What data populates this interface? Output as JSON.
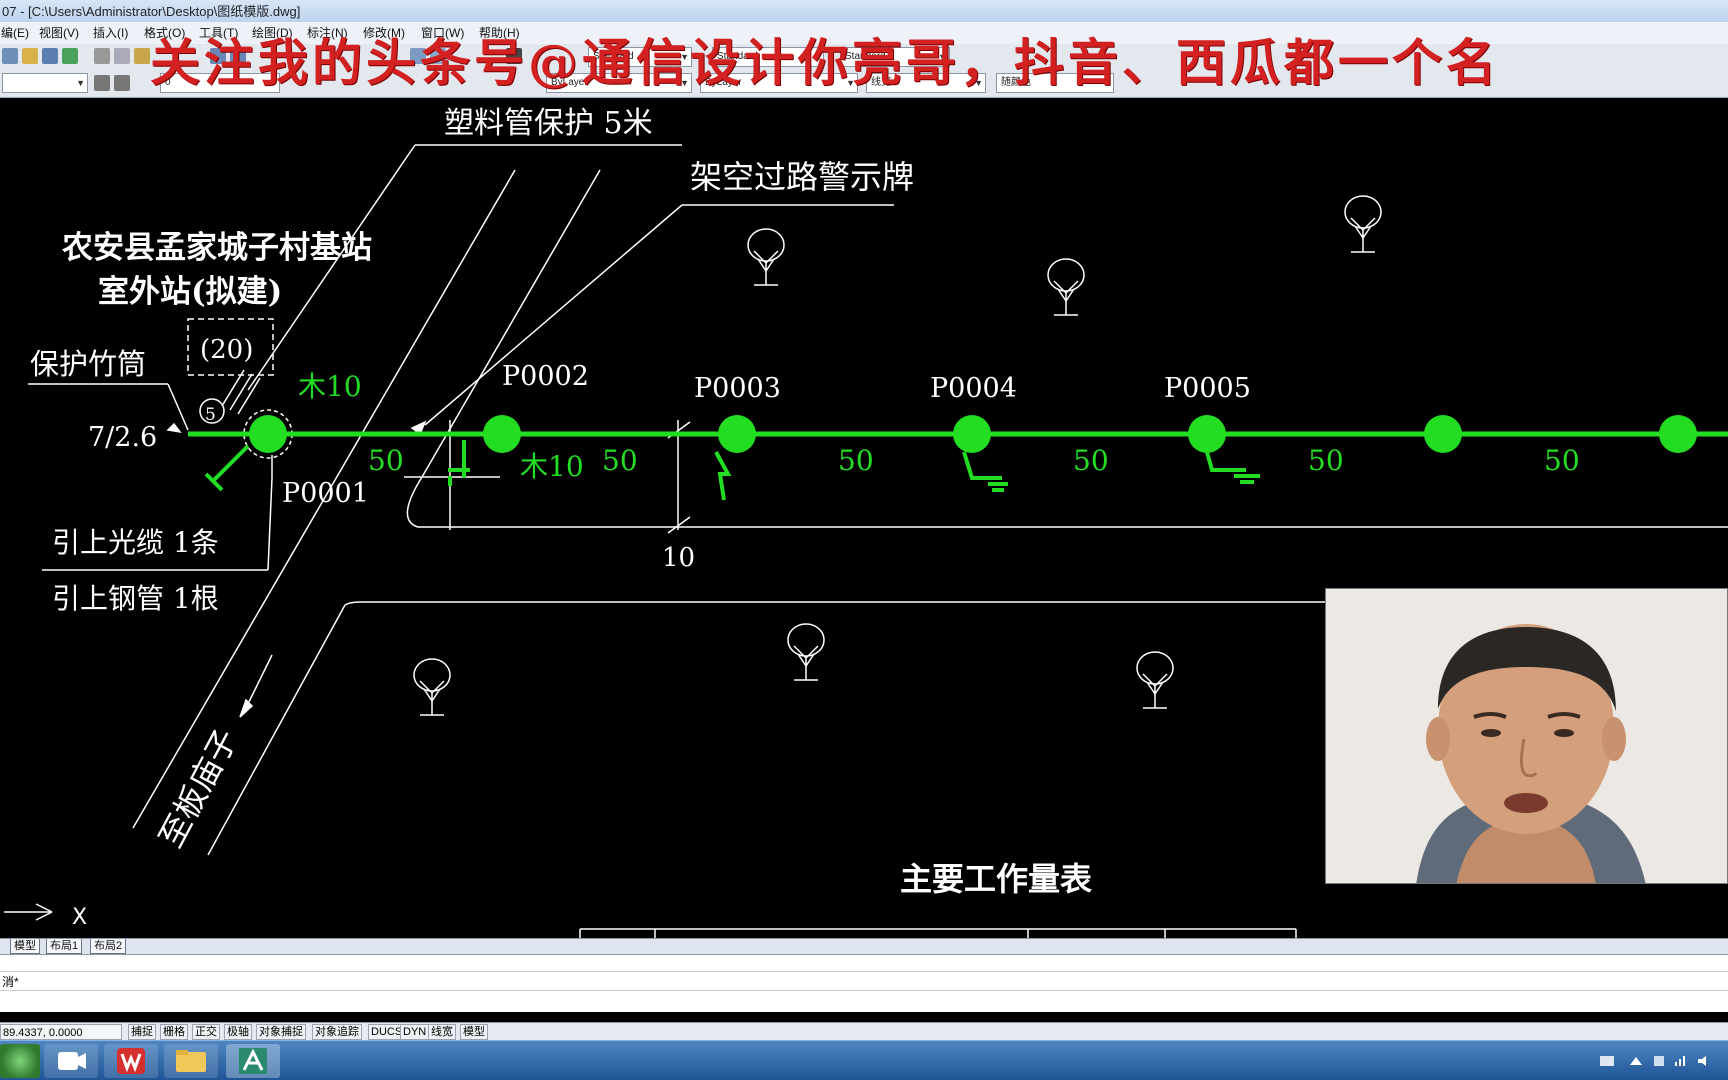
{
  "window": {
    "title": "07 - [C:\\Users\\Administrator\\Desktop\\图纸模版.dwg]"
  },
  "menu": {
    "items": [
      "编(E)",
      "视图(V)",
      "插入(I)",
      "格式(O)",
      "工具(T)",
      "绘图(D)",
      "标注(N)",
      "修改(M)",
      "窗口(W)",
      "帮助(H)"
    ]
  },
  "toolbar": {
    "text_style": "Standard",
    "dim_style": "Standard",
    "table_style": "Standard",
    "layer": "0",
    "color": "ByLayer",
    "linetype": "ByLayer",
    "lineweight": "线宽",
    "plotstyle": "随颜色"
  },
  "banner": {
    "text": "关注我的头条号@通信设计你亮哥，抖音、西瓜都一个名"
  },
  "drawing": {
    "colors": {
      "line_green": "#22dd22",
      "text_white": "#ffffff",
      "background": "#000000"
    },
    "labels": {
      "plastic_pipe": "塑料管保护 5米",
      "sign": "架空过路警示牌",
      "station_line1": "农安县孟家城子村基站",
      "station_line2": "室外站(拟建)",
      "bamboo": "保护竹筒",
      "paren20": "(20)",
      "circled5": "5",
      "cable_spec": "7/2.6",
      "cable_up": "引上光缆 1条",
      "steel_up": "引上钢管 1根",
      "road": "至板庙子",
      "span10": "10",
      "table_title": "主要工作量表",
      "wood1": "木10",
      "wood2": "木10",
      "axis_x": "X"
    },
    "poles": [
      "P0001",
      "P0002",
      "P0003",
      "P0004",
      "P0005"
    ],
    "spans": [
      "50",
      "50",
      "50",
      "50",
      "50",
      "50"
    ]
  },
  "layout_tabs": [
    "模型",
    "布局1",
    "布局2"
  ],
  "command": {
    "text": "消*"
  },
  "status": {
    "coords": "89.4337, 0.0000",
    "toggles": [
      "捕捉",
      "栅格",
      "正交",
      "极轴",
      "对象捕捉",
      "对象追踪",
      "DUCS",
      "DYN",
      "线宽",
      "模型"
    ]
  },
  "taskbar": {
    "apps": [
      "start-orb",
      "video-app",
      "wps-app",
      "file-explorer",
      "autocad-app"
    ]
  }
}
